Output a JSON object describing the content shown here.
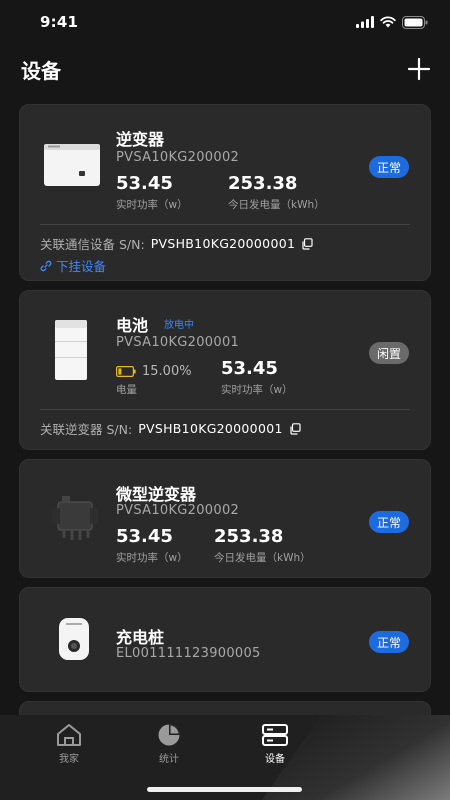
{
  "status_bar": {
    "time": "9:41"
  },
  "header": {
    "title": "设备"
  },
  "devices": [
    {
      "name": "逆变器",
      "sn": "PVSA10KG200002",
      "status": "正常",
      "metrics": [
        {
          "value": "53.45",
          "label": "实时功率（w）"
        },
        {
          "value": "253.38",
          "label": "今日发电量（kWh）"
        }
      ],
      "link_label": "关联通信设备 S/N:",
      "link_sn": "PVSHB10KG20000001",
      "sub_link": "下挂设备"
    },
    {
      "name": "电池",
      "tag": "放电中",
      "sn": "PVSA10KG200001",
      "status": "闲置",
      "soc_value": "15.00%",
      "soc_label": "电量",
      "metrics": [
        {
          "value": "53.45",
          "label": "实时功率（w）"
        }
      ],
      "link_label": "关联逆变器 S/N:",
      "link_sn": "PVSHB10KG20000001"
    },
    {
      "name": "微型逆变器",
      "sn": "PVSA10KG200002",
      "status": "正常",
      "metrics": [
        {
          "value": "53.45",
          "label": "实时功率（w）"
        },
        {
          "value": "253.38",
          "label": "今日发电量（kWh）"
        }
      ]
    },
    {
      "name": "充电桩",
      "sn": "EL001111123900005",
      "status": "正常"
    }
  ],
  "tabs": [
    {
      "label": "我家",
      "icon": "home-icon",
      "active": false
    },
    {
      "label": "统计",
      "icon": "pie-chart-icon",
      "active": false
    },
    {
      "label": "设备",
      "icon": "device-icon",
      "active": true
    }
  ],
  "colors": {
    "accent": "#1e6be0",
    "link": "#3d86ff",
    "card": "#2a2a2a",
    "battery_low": "#e8b923"
  }
}
